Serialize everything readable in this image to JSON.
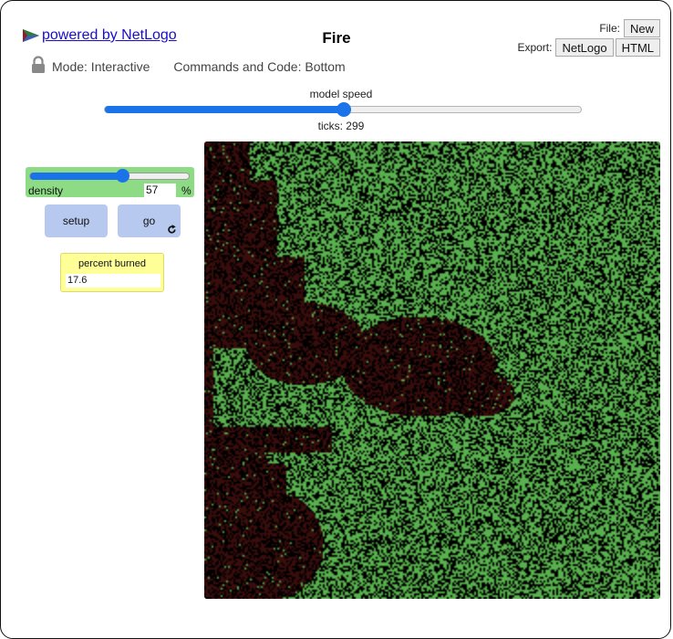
{
  "header": {
    "powered_label": "powered by NetLogo",
    "title": "Fire",
    "file_label": "File:",
    "new_label": "New",
    "export_label": "Export:",
    "export_netlogo_label": "NetLogo",
    "export_html_label": "HTML",
    "mode_label": "Mode: Interactive",
    "commands_label": "Commands and Code: Bottom"
  },
  "speed": {
    "label": "model speed",
    "value_fraction": 0.5,
    "ticks_label": "ticks: 299"
  },
  "density_slider": {
    "label": "density",
    "value": "57",
    "unit": "%",
    "min": 0,
    "max": 99,
    "numeric": 57
  },
  "buttons": {
    "setup_label": "setup",
    "go_label": "go"
  },
  "monitor": {
    "label": "percent burned",
    "value": "17.6"
  },
  "colors": {
    "tree": "#59b04e",
    "ash": "#3a0d0d",
    "empty": "#000000",
    "slider_accent": "#1a73e8",
    "slider_bg": "#8edb86",
    "button_bg": "#b7c9ef",
    "monitor_bg": "#ffff98"
  }
}
